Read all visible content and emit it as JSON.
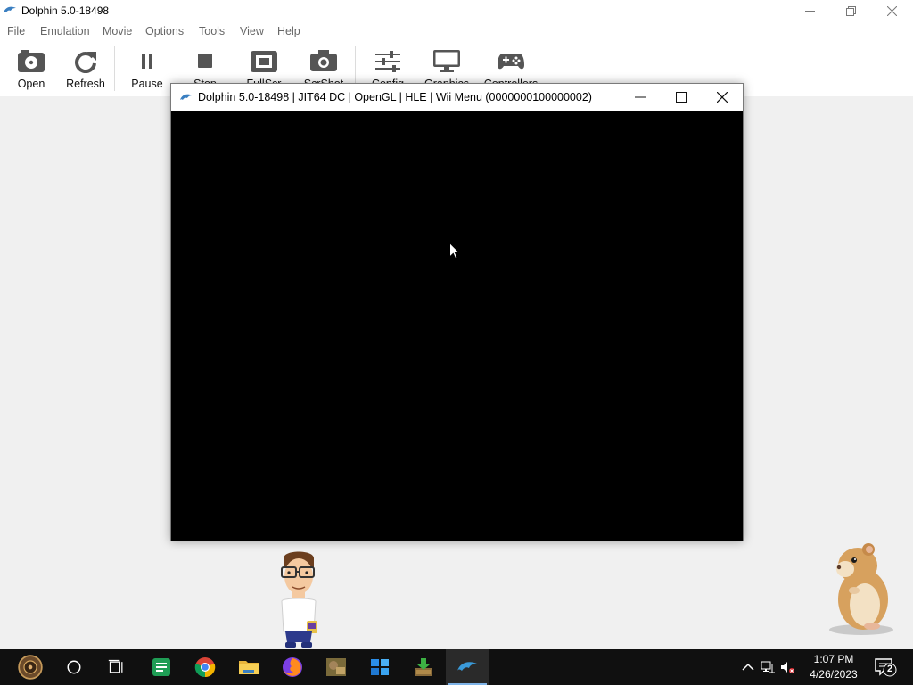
{
  "main_window": {
    "title": "Dolphin 5.0-18498"
  },
  "menu": [
    "File",
    "Emulation",
    "Movie",
    "Options",
    "Tools",
    "View",
    "Help"
  ],
  "toolbar": {
    "open": "Open",
    "refresh": "Refresh",
    "pause": "Pause",
    "stop": "Stop",
    "fullscreen": "FullScr",
    "screenshot": "ScrShot",
    "config": "Config",
    "graphics": "Graphics",
    "controllers": "Controllers"
  },
  "render_window": {
    "title": "Dolphin 5.0-18498 | JIT64 DC | OpenGL | HLE | Wii Menu (0000000100000002)"
  },
  "taskbar": {
    "apps": [
      "start-icon",
      "cortana-icon",
      "task-view-icon",
      "green-app-icon",
      "chrome-icon",
      "file-explorer-icon",
      "firefox-icon",
      "game-icon",
      "windows-store-icon",
      "download-app-icon",
      "dolphin-icon"
    ],
    "time": "1:07 PM",
    "date": "4/26/2023",
    "notification_count": "2"
  },
  "colors": {
    "taskbar": "#101010",
    "workspace": "#f0f0f0",
    "dolphin_blue": "#3a7fc1",
    "active_indicator": "#7fb4e8"
  }
}
